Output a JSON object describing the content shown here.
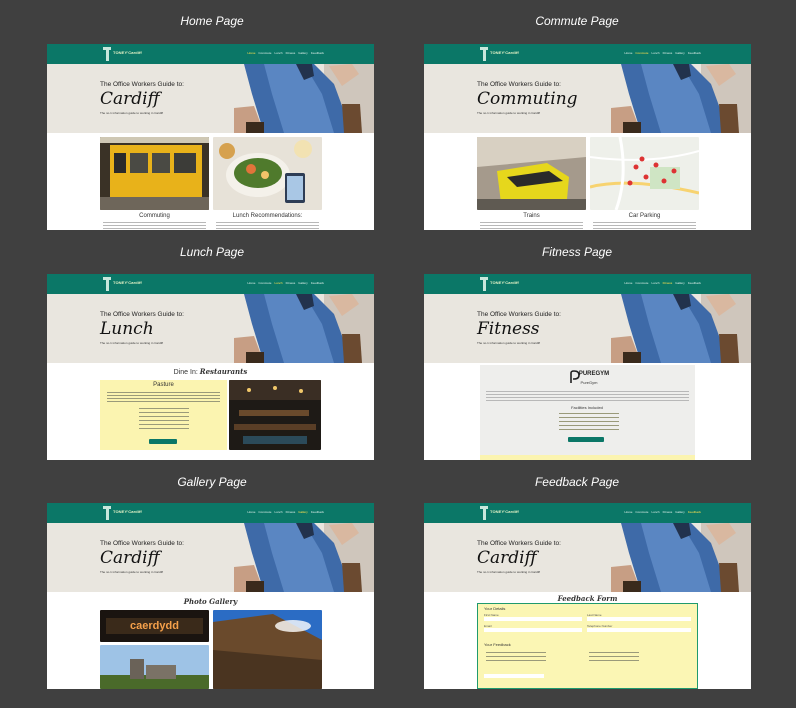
{
  "captions": {
    "home": "Home Page",
    "commute": "Commute Page",
    "lunch": "Lunch Page",
    "fitness": "Fitness Page",
    "gallery": "Gallery Page",
    "feedback": "Feedback Page"
  },
  "site": {
    "logo_text": "TONEY'Cardiff",
    "nav": [
      "Home",
      "Commute",
      "Lunch",
      "Fitness",
      "Gallery",
      "Feedback"
    ],
    "hero_intro": "The Office Workers Guide to:",
    "hero_tagline": "The no.1 information guide to working in Cardiff"
  },
  "pages": {
    "home": {
      "title": "Cardiff",
      "active_nav": 0,
      "cards": [
        "Commuting",
        "Lunch Recommendations:"
      ]
    },
    "commute": {
      "title": "Commuting",
      "active_nav": 1,
      "cards": [
        "Trains",
        "Car Parking"
      ]
    },
    "lunch": {
      "title": "Lunch",
      "active_nav": 2,
      "heading_prefix": "Dine In:",
      "heading_em": "Restaurants",
      "restaurant": "Pasture"
    },
    "fitness": {
      "title": "Fitness",
      "active_nav": 3,
      "brand": "PUREGYM",
      "brand_sub": "PureGym",
      "facilities": "Facilities Included"
    },
    "gallery": {
      "title": "Cardiff",
      "active_nav": 4,
      "heading": "Photo Gallery",
      "sign_text": "caerdydd"
    },
    "feedback": {
      "title": "Cardiff",
      "active_nav": 5,
      "heading": "Feedback Form",
      "your_details": "Your Details",
      "your_feedback": "Your Feedback",
      "labels": [
        "First Name",
        "Last Name",
        "Email",
        "Telephone Number"
      ]
    }
  },
  "colors": {
    "background": "#404040",
    "nav": "#0b7767",
    "hero": "#e9e6df",
    "highlight_yellow": "#fbf4b0",
    "nav_active": "#ffe04d"
  }
}
